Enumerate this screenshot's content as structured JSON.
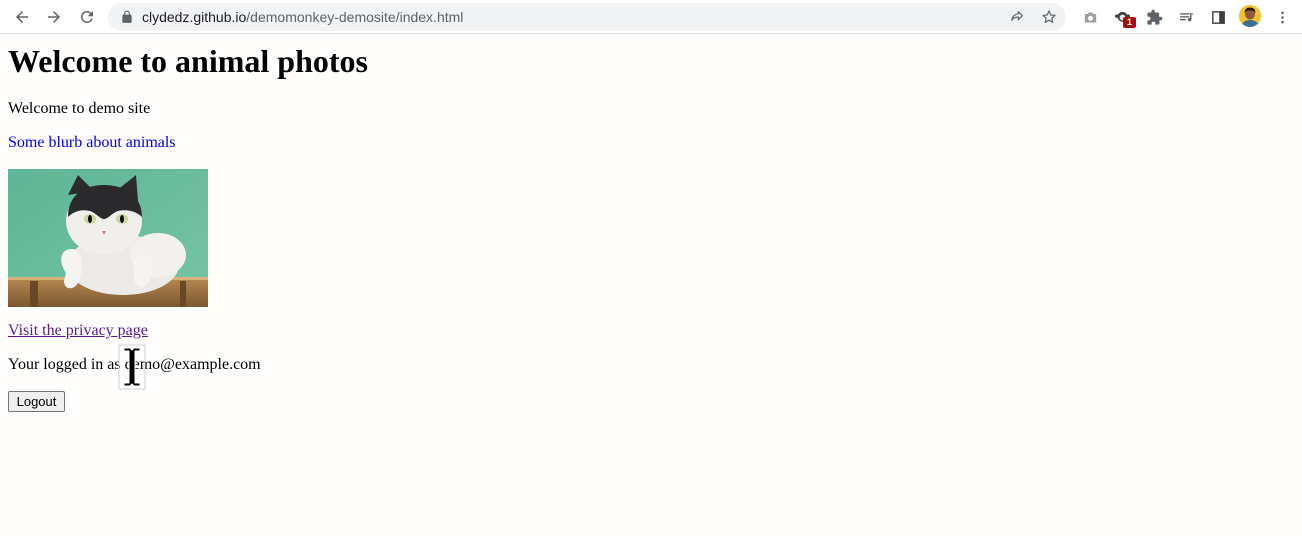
{
  "browser": {
    "url_host": "clydedz.github.io",
    "url_path": "/demomonkey-demosite/index.html",
    "extension_badge": "1",
    "icons": [
      "back-icon",
      "forward-icon",
      "reload-icon",
      "lock-icon",
      "share-icon",
      "star-icon",
      "camera-icon",
      "extension-icon",
      "puzzle-icon",
      "reading-list-icon",
      "side-panel-icon",
      "avatar",
      "kebab-menu-icon"
    ]
  },
  "page": {
    "heading": "Welcome to animal photos",
    "welcome_text": "Welcome to demo site",
    "blurb_text": "Some blurb about animals",
    "privacy_link": "Visit the privacy page",
    "logged_in_text": "Your logged in as demo@example.com",
    "logout_button": "Logout"
  },
  "colors": {
    "link_blue": "#0000ee",
    "visited_link": "#551a8b",
    "badge_red": "#a50e0e"
  }
}
